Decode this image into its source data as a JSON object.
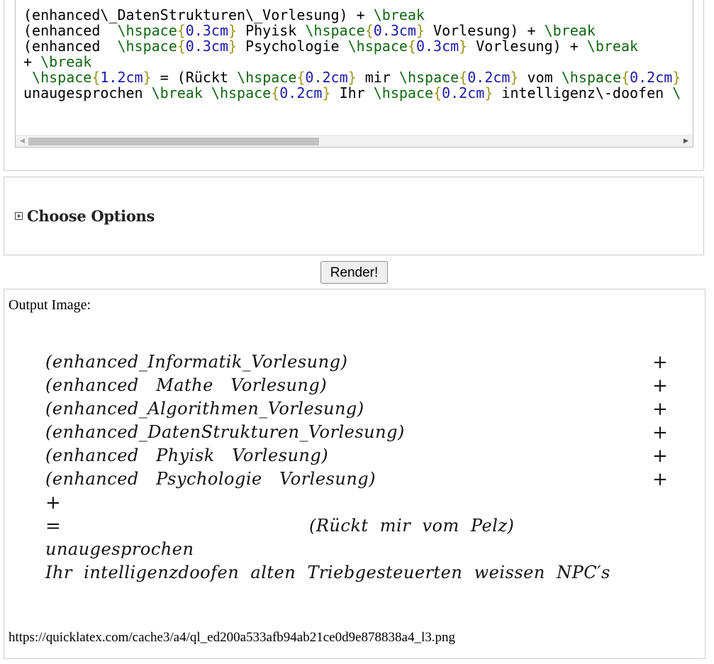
{
  "editor": {
    "lines": [
      [
        {
          "t": "(enhanced\\_DatenStrukturen\\_Vorlesung) + ",
          "c": ""
        },
        {
          "t": "\\break",
          "c": "cmd"
        }
      ],
      [
        {
          "t": "(enhanced  ",
          "c": ""
        },
        {
          "t": "\\hspace",
          "c": "cmd"
        },
        {
          "t": "{",
          "c": "brace"
        },
        {
          "t": "0.3cm",
          "c": "num"
        },
        {
          "t": "}",
          "c": "brace"
        },
        {
          "t": " Phyisk ",
          "c": ""
        },
        {
          "t": "\\hspace",
          "c": "cmd"
        },
        {
          "t": "{",
          "c": "brace"
        },
        {
          "t": "0.3cm",
          "c": "num"
        },
        {
          "t": "}",
          "c": "brace"
        },
        {
          "t": " Vorlesung) + ",
          "c": ""
        },
        {
          "t": "\\break",
          "c": "cmd"
        }
      ],
      [
        {
          "t": "(enhanced  ",
          "c": ""
        },
        {
          "t": "\\hspace",
          "c": "cmd"
        },
        {
          "t": "{",
          "c": "brace"
        },
        {
          "t": "0.3cm",
          "c": "num"
        },
        {
          "t": "}",
          "c": "brace"
        },
        {
          "t": " Psychologie ",
          "c": ""
        },
        {
          "t": "\\hspace",
          "c": "cmd"
        },
        {
          "t": "{",
          "c": "brace"
        },
        {
          "t": "0.3cm",
          "c": "num"
        },
        {
          "t": "}",
          "c": "brace"
        },
        {
          "t": " Vorlesung) + ",
          "c": ""
        },
        {
          "t": "\\break",
          "c": "cmd"
        }
      ],
      [
        {
          "t": "+ ",
          "c": ""
        },
        {
          "t": "\\break",
          "c": "cmd"
        }
      ],
      [
        {
          "t": " ",
          "c": ""
        },
        {
          "t": "\\hspace",
          "c": "cmd"
        },
        {
          "t": "{",
          "c": "brace"
        },
        {
          "t": "1.2cm",
          "c": "num"
        },
        {
          "t": "}",
          "c": "brace"
        },
        {
          "t": " = (Rückt ",
          "c": ""
        },
        {
          "t": "\\hspace",
          "c": "cmd"
        },
        {
          "t": "{",
          "c": "brace"
        },
        {
          "t": "0.2cm",
          "c": "num"
        },
        {
          "t": "}",
          "c": "brace"
        },
        {
          "t": " mir ",
          "c": ""
        },
        {
          "t": "\\hspace",
          "c": "cmd"
        },
        {
          "t": "{",
          "c": "brace"
        },
        {
          "t": "0.2cm",
          "c": "num"
        },
        {
          "t": "}",
          "c": "brace"
        },
        {
          "t": " vom ",
          "c": ""
        },
        {
          "t": "\\hspace",
          "c": "cmd"
        },
        {
          "t": "{",
          "c": "brace"
        },
        {
          "t": "0.2cm",
          "c": "num"
        },
        {
          "t": "}",
          "c": "brace"
        }
      ],
      [
        {
          "t": "unaugesprochen ",
          "c": ""
        },
        {
          "t": "\\break",
          "c": "cmd"
        },
        {
          "t": " ",
          "c": ""
        },
        {
          "t": "\\hspace",
          "c": "cmd"
        },
        {
          "t": "{",
          "c": "brace"
        },
        {
          "t": "0.2cm",
          "c": "num"
        },
        {
          "t": "}",
          "c": "brace"
        },
        {
          "t": " Ihr ",
          "c": ""
        },
        {
          "t": "\\hspace",
          "c": "cmd"
        },
        {
          "t": "{",
          "c": "brace"
        },
        {
          "t": "0.2cm",
          "c": "num"
        },
        {
          "t": "}",
          "c": "brace"
        },
        {
          "t": " intelligenz\\-doofen ",
          "c": ""
        },
        {
          "t": "\\",
          "c": "cmd"
        }
      ]
    ],
    "colors": {
      "cmd": "#116611",
      "brace": "#999922",
      "num": "#1a1aa6"
    }
  },
  "options": {
    "title": "Choose Options",
    "expand_icon": "plus-box-icon"
  },
  "render_button": {
    "label": "Render!"
  },
  "output": {
    "label": "Output Image:",
    "rendered_lines": [
      {
        "text": "(enhanced_Informatik_Vorlesung)",
        "plus": "+"
      },
      {
        "text": "(enhanced   Mathe   Vorlesung)",
        "plus": "+"
      },
      {
        "text": "(enhanced_Algorithmen_Vorlesung)",
        "plus": "+"
      },
      {
        "text": "(enhanced_DatenStrukturen_Vorlesung)",
        "plus": "+"
      },
      {
        "text": "(enhanced   Phyisk   Vorlesung)",
        "plus": "+"
      },
      {
        "text": "(enhanced   Psychologie   Vorlesung)",
        "plus": "+"
      }
    ],
    "plus_line": "+",
    "equals": "=",
    "centered": "(Rückt  mir  vom  Pelz)",
    "line_unaugesprochen": "unaugesprochen",
    "line_final": "Ihr  intelligenzdoofen  alten  Triebgesteuerten  weissen  NPC′s",
    "url": "https://quicklatex.com/cache3/a4/ql_ed200a533afb94ab21ce0d9e878838a4_l3.png"
  }
}
